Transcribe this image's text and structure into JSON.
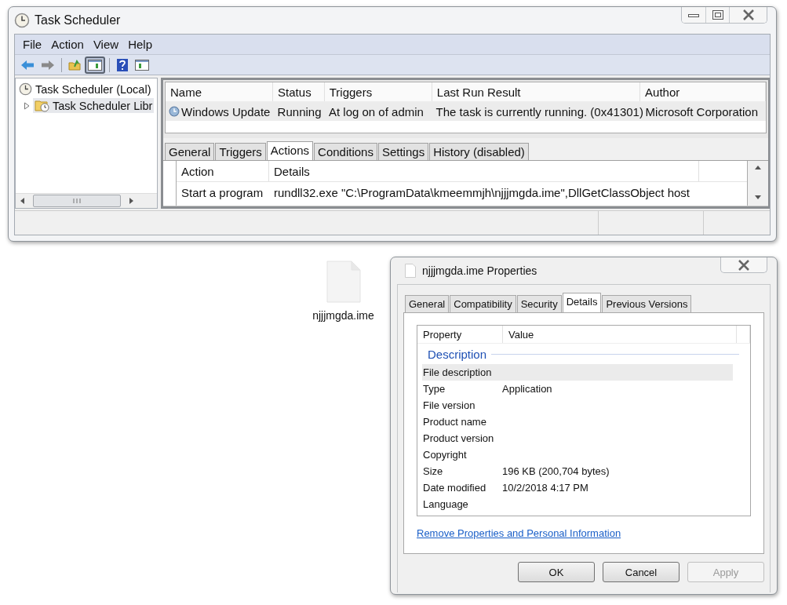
{
  "task_scheduler": {
    "title": "Task Scheduler",
    "menu": [
      "File",
      "Action",
      "View",
      "Help"
    ],
    "toolbar_groups": [
      {
        "buttons": [
          {
            "kind": "back",
            "pressed": false
          },
          {
            "kind": "forward",
            "pressed": false
          }
        ]
      },
      {
        "buttons": [
          {
            "kind": "up-folder",
            "pressed": false
          },
          {
            "kind": "console-tree",
            "pressed": true
          }
        ]
      },
      {
        "buttons": [
          {
            "kind": "help",
            "pressed": false
          },
          {
            "kind": "action-pane",
            "pressed": false
          }
        ]
      }
    ],
    "tree": [
      {
        "label": "Task Scheduler (Local)",
        "selected": false,
        "children": [
          {
            "label": "Task Scheduler Libr",
            "selected": true,
            "expanded": false
          }
        ]
      }
    ],
    "task_table": {
      "columns": [
        "Name",
        "Status",
        "Triggers",
        "Last Run Result",
        "Author"
      ],
      "rows": [
        {
          "selected": true,
          "cells": [
            "Windows Update",
            "Running",
            "At log on of admin",
            "The task is currently running. (0x41301)",
            "Microsoft Corporation"
          ]
        }
      ]
    },
    "tabs": [
      {
        "label": "General",
        "selected": false
      },
      {
        "label": "Triggers",
        "selected": false
      },
      {
        "label": "Actions",
        "selected": true
      },
      {
        "label": "Conditions",
        "selected": false
      },
      {
        "label": "Settings",
        "selected": false
      },
      {
        "label": "History (disabled)",
        "selected": false
      }
    ],
    "actions_table": {
      "columns": [
        "Action",
        "Details"
      ],
      "rows": [
        [
          "Start a program",
          "rundll32.exe \"C:\\ProgramData\\kmeemmjh\\njjjmgda.ime\",DllGetClassObject host"
        ]
      ]
    }
  },
  "desktop_file": {
    "label": "njjjmgda.ime"
  },
  "properties": {
    "title": "njjjmgda.ime Properties",
    "tabs": [
      {
        "label": "General",
        "selected": false
      },
      {
        "label": "Compatibility",
        "selected": false
      },
      {
        "label": "Security",
        "selected": false
      },
      {
        "label": "Details",
        "selected": true
      },
      {
        "label": "Previous Versions",
        "selected": false
      }
    ],
    "columns": [
      "Property",
      "Value"
    ],
    "group": "Description",
    "rows": [
      {
        "property": "File description",
        "selected": true
      },
      {
        "property": "Type",
        "value": "Application",
        "selected": false
      },
      {
        "property": "File version",
        "selected": false
      },
      {
        "property": "Product name",
        "selected": false
      },
      {
        "property": "Product version",
        "selected": false
      },
      {
        "property": "Copyright",
        "selected": false
      },
      {
        "property": "Size",
        "value": "196 KB (200,704 bytes)",
        "selected": false
      },
      {
        "property": "Date modified",
        "value": "10/2/2018 4:17 PM",
        "selected": false
      },
      {
        "property": "Language",
        "selected": false
      }
    ],
    "link": "Remove Properties and Personal Information",
    "buttons": [
      {
        "label": "OK",
        "disabled": false
      },
      {
        "label": "Cancel",
        "disabled": false
      },
      {
        "label": "Apply",
        "disabled": true
      }
    ]
  }
}
